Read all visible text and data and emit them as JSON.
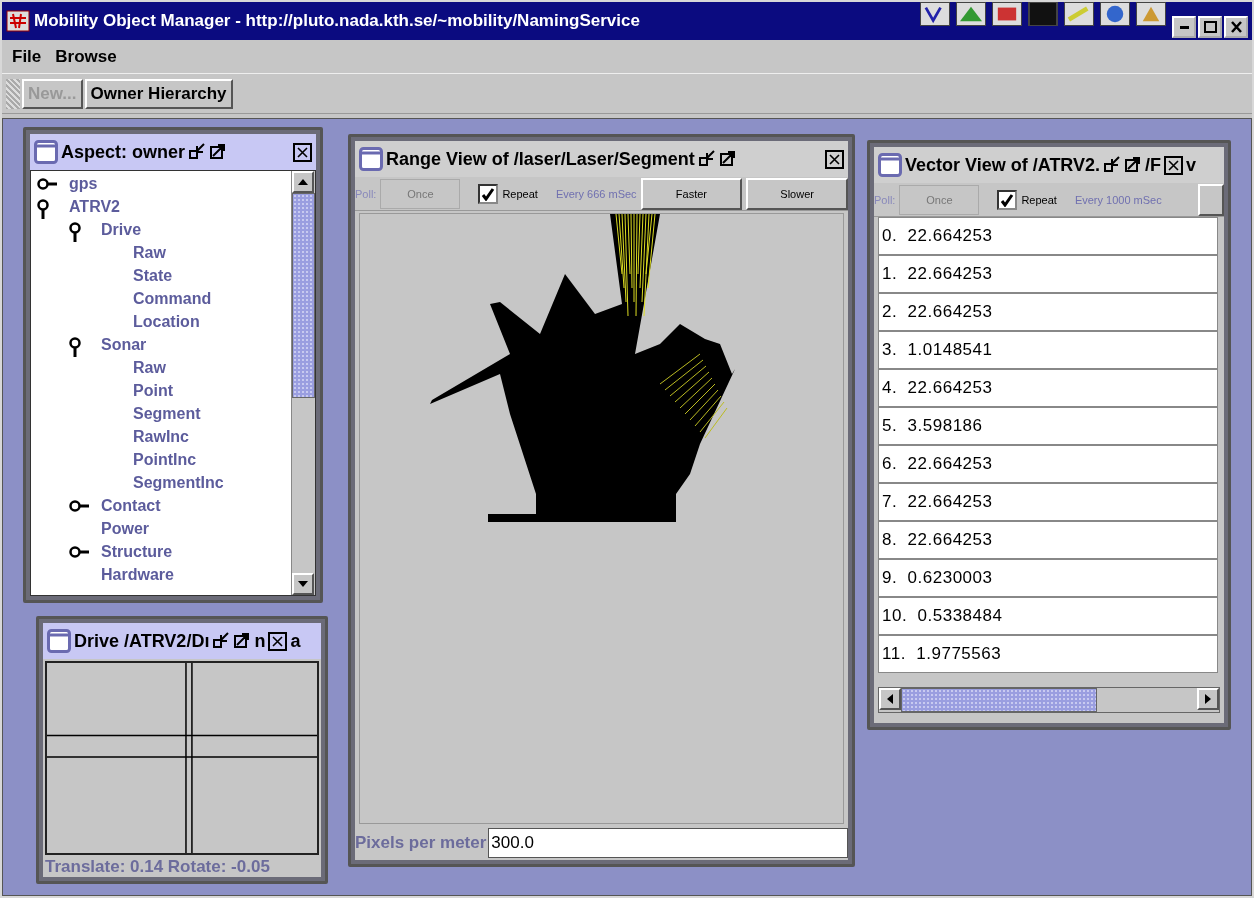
{
  "window": {
    "title": "Mobility Object Manager - http://pluto.nada.kth.se/~mobility/NamingService"
  },
  "menu": [
    "File",
    "Browse"
  ],
  "toolbar": [
    {
      "label": "New...",
      "disabled": true
    },
    {
      "label": "Owner Hierarchy",
      "disabled": false
    }
  ],
  "frames": [
    {
      "kind": "tree",
      "title": "Aspect: owner",
      "active": true,
      "tree": [
        {
          "label": "gps",
          "expanded": false
        },
        {
          "label": "ATRV2",
          "expanded": true,
          "children": [
            {
              "label": "Drive",
              "expanded": true,
              "children": [
                {
                  "label": "Raw"
                },
                {
                  "label": "State"
                },
                {
                  "label": "Command"
                },
                {
                  "label": "Location"
                }
              ]
            },
            {
              "label": "Sonar",
              "expanded": true,
              "children": [
                {
                  "label": "Raw"
                },
                {
                  "label": "Point"
                },
                {
                  "label": "Segment"
                },
                {
                  "label": "RawInc"
                },
                {
                  "label": "PointInc"
                },
                {
                  "label": "SegmentInc"
                }
              ]
            },
            {
              "label": "Contact",
              "expanded": false
            },
            {
              "label": "Power"
            },
            {
              "label": "Structure",
              "expanded": false
            },
            {
              "label": "Hardware"
            }
          ]
        }
      ]
    },
    {
      "kind": "drive",
      "title": "Drive /ATRV2/Dı",
      "active": true,
      "title_fragments": [
        "n",
        "a"
      ],
      "status": "Translate: 0.14 Rotate: -0.05"
    },
    {
      "kind": "range",
      "title": "Range View of /laser/Laser/Segment",
      "active": false,
      "poll": {
        "label": "Poll:",
        "once": {
          "label": "Once",
          "disabled": true
        },
        "repeat": {
          "label": "Repeat",
          "checked": true
        },
        "interval": "Every 666 mSec",
        "buttons": [
          "Faster",
          "Slower"
        ]
      },
      "scale": {
        "label": "Pixels per meter",
        "value": "300.0"
      }
    },
    {
      "kind": "vector",
      "title": "Vector View of /ATRV2.",
      "active": false,
      "title_fragments": [
        "/F",
        "v"
      ],
      "poll": {
        "label": "Poll:",
        "once": {
          "label": "Once",
          "disabled": true
        },
        "repeat": {
          "label": "Repeat",
          "checked": true
        },
        "interval": "Every 1000 mSec"
      },
      "rows": [
        "0.  22.664253",
        "1.  22.664253",
        "2.  22.664253",
        "3.  1.0148541",
        "4.  22.664253",
        "5.  3.598186",
        "6.  22.664253",
        "7.  22.664253",
        "8.  22.664253",
        "9.  0.6230003",
        "10.  0.5338484",
        "11.  1.9775563"
      ]
    }
  ]
}
